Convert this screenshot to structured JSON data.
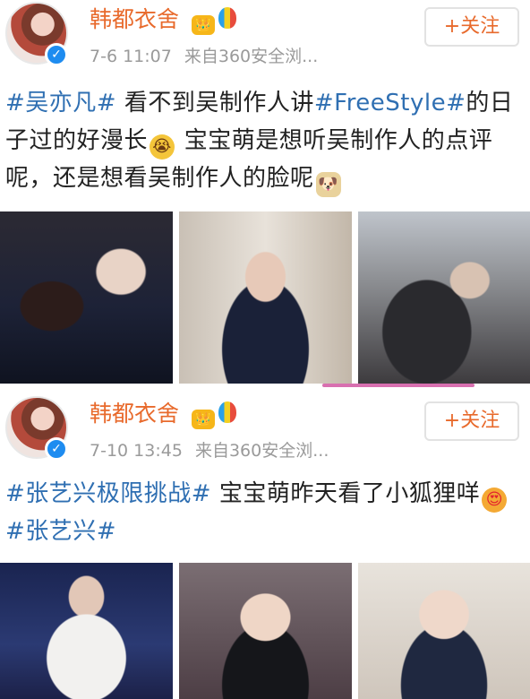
{
  "posts": [
    {
      "user_name": "韩都衣舍",
      "verified_mark": "✓",
      "crown_glyph": "👑",
      "time": "7-6 11:07",
      "source": "来自360安全浏...",
      "follow_label": "+关注",
      "text": {
        "tag1": "#吴亦凡#",
        "part1": " 看不到吴制作人讲",
        "tag2": "#FreeStyle#",
        "part2": "的日子过的好漫长",
        "emoji1": "😭",
        "part3": " 宝宝萌是想听吴制作人的点评呢，还是想看吴制作人的脸呢",
        "emoji2": "🐶"
      }
    },
    {
      "user_name": "韩都衣舍",
      "verified_mark": "✓",
      "crown_glyph": "👑",
      "time": "7-10 13:45",
      "source": "来自360安全浏...",
      "follow_label": "+关注",
      "text": {
        "tag1": "#张艺兴极限挑战#",
        "part1": " 宝宝萌昨天看了小狐狸咩",
        "emoji1": "😍",
        "tag2": "#张艺兴#"
      }
    }
  ],
  "colors": {
    "name": "#e86a2c",
    "tag": "#2f6fb2",
    "meta": "#9a9a9a"
  }
}
